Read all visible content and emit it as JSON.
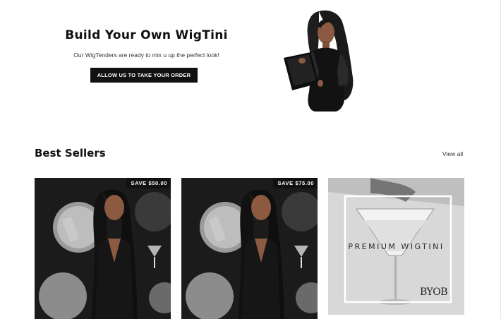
{
  "hero": {
    "title": "Build Your Own WigTini",
    "subtitle": "Our WigTenders are ready to mix u up the perfect look!",
    "cta_label": "ALLOW US TO TAKE YOUR ORDER"
  },
  "best_sellers": {
    "title": "Best Sellers",
    "view_all_label": "View all",
    "products": [
      {
        "badge": "SAVE $50.00"
      },
      {
        "badge": "SAVE $75.00"
      },
      {
        "overlay_title": "PREMIUM WIGTINI",
        "overlay_logo": "BYOB"
      }
    ]
  },
  "colors": {
    "button_bg": "#111111",
    "badge_bg": "#111111"
  }
}
